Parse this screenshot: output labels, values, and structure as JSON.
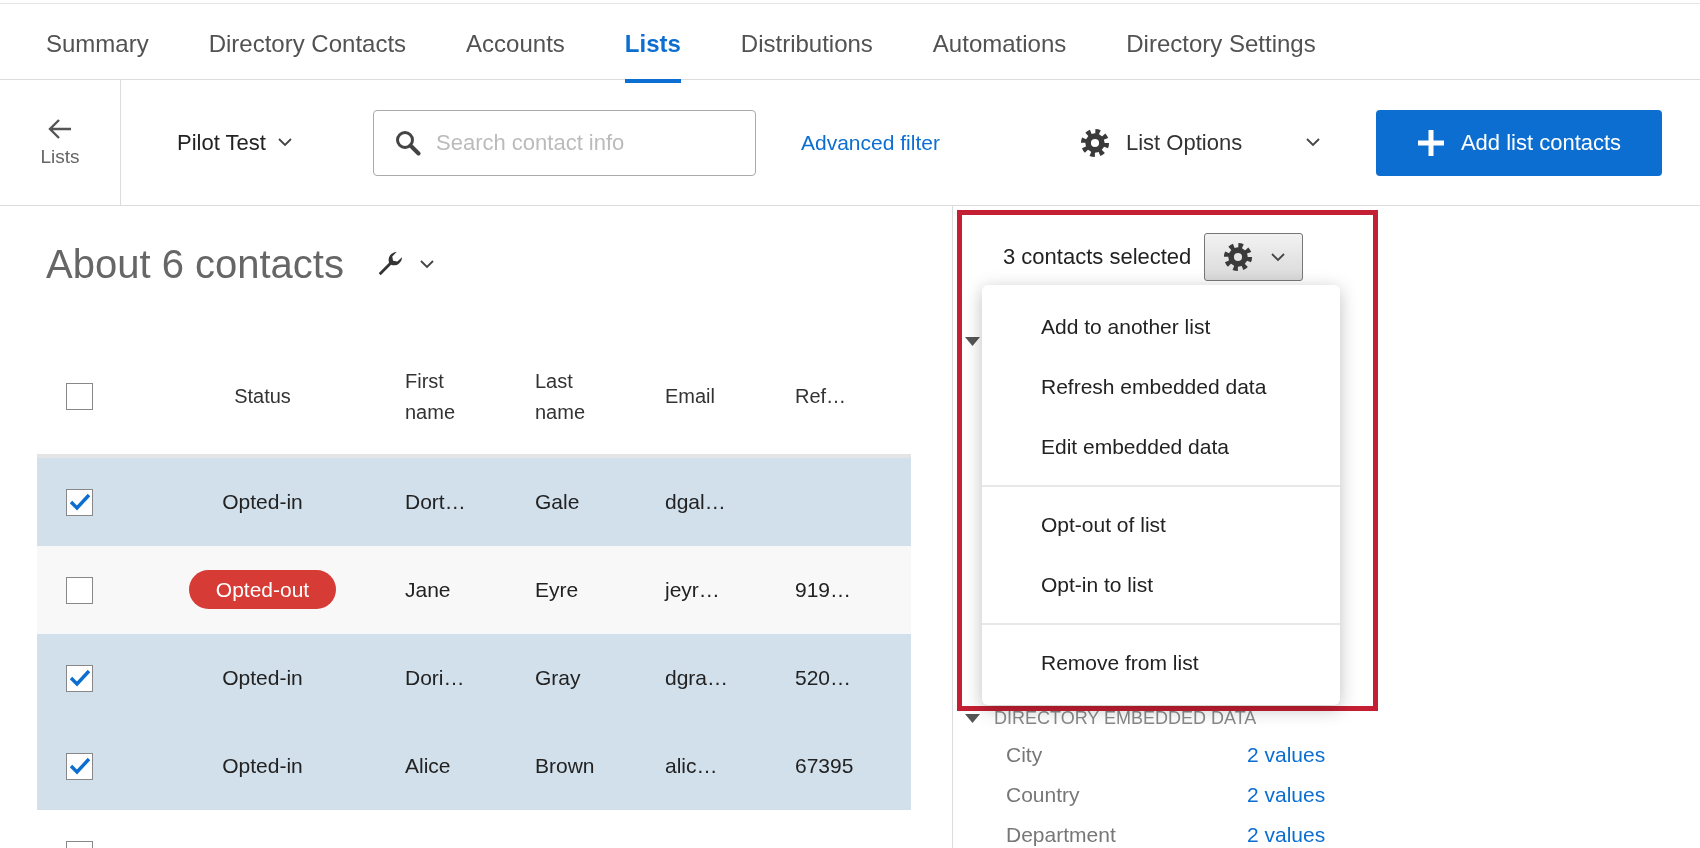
{
  "tabs": [
    {
      "label": "Summary",
      "selected": false
    },
    {
      "label": "Directory Contacts",
      "selected": false
    },
    {
      "label": "Accounts",
      "selected": false
    },
    {
      "label": "Lists",
      "selected": true
    },
    {
      "label": "Distributions",
      "selected": false
    },
    {
      "label": "Automations",
      "selected": false
    },
    {
      "label": "Directory Settings",
      "selected": false
    }
  ],
  "toolbar": {
    "back_label": "Lists",
    "list_name": "Pilot Test",
    "search": {
      "placeholder": "Search contact info"
    },
    "advanced_filter": "Advanced filter",
    "list_options": "List Options",
    "add_button": "Add list contacts"
  },
  "contacts": {
    "heading": "About 6 contacts",
    "header_checked": false,
    "columns": [
      "Status",
      "First name",
      "Last name",
      "Email",
      "Ref…"
    ],
    "rows": [
      {
        "checked": true,
        "status": {
          "text": "Opted-in",
          "kind": "plain"
        },
        "first_name": "Dort…",
        "last_name": "Gale",
        "email": "dgal…"
      },
      {
        "checked": false,
        "status": {
          "text": "Opted-out",
          "kind": "badge"
        },
        "first_name": "Jane",
        "last_name": "Eyre",
        "email": "jeyr…",
        "ref": "919…"
      },
      {
        "checked": true,
        "status": {
          "text": "Opted-in",
          "kind": "plain"
        },
        "first_name": "Dori…",
        "last_name": "Gray",
        "email": "dgra…",
        "ref": "520…"
      },
      {
        "checked": true,
        "status": {
          "text": "Opted-in",
          "kind": "plain"
        },
        "first_name": "Alice",
        "last_name": "Brown",
        "email": "alic…",
        "ref": "67395"
      },
      {
        "checked": false
      }
    ]
  },
  "selection_panel": {
    "selected_count": "3 contacts selected",
    "menu_groups": [
      [
        "Add to another list",
        "Refresh embedded data",
        "Edit embedded data"
      ],
      [
        "Opt-out of list",
        "Opt-in to list"
      ],
      [
        "Remove from list"
      ]
    ],
    "section_header": "DIRECTORY EMBEDDED DATA",
    "fields": [
      {
        "name": "City",
        "value": "2 values"
      },
      {
        "name": "Country",
        "value": "2 values"
      },
      {
        "name": "Department",
        "value": "2 values"
      }
    ]
  }
}
